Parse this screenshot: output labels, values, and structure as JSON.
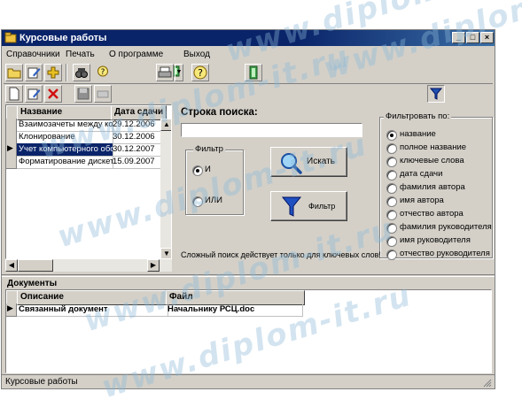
{
  "window": {
    "title": "Курсовые работы"
  },
  "menu": {
    "items": [
      "Справочники",
      "Печать",
      "О программе",
      "Выход"
    ]
  },
  "courses_grid": {
    "columns": [
      "Название",
      "Дата сдачи"
    ],
    "rows": [
      {
        "name": "Взаимозачеты между ко",
        "date": "29.12.2006"
      },
      {
        "name": "Клонирование",
        "date": "30.12.2006"
      },
      {
        "name": "Учет компьютерного обо",
        "date": "30.12.2007"
      },
      {
        "name": "Форматирование дискет",
        "date": "15.09.2007"
      }
    ],
    "selected_row": 2
  },
  "search": {
    "label": "Строка поиска:",
    "value": "",
    "search_button": "Искать",
    "filter_button": "Фильтр",
    "hint": "Сложный поиск действует только для ключевых слов!"
  },
  "filter_mode": {
    "title": "Фильтр",
    "options": [
      "И",
      "ИЛИ"
    ],
    "selected": "И"
  },
  "filter_by": {
    "title": "Фильтровать по:",
    "options": [
      "название",
      "полное название",
      "ключевые слова",
      "дата сдачи",
      "фамилия автора",
      "имя автора",
      "отчество автора",
      "фамилия руководителя",
      "имя руководителя",
      "отчество руководителя"
    ],
    "selected": "название"
  },
  "documents": {
    "title": "Документы",
    "columns": [
      "Описание",
      "Файл"
    ],
    "rows": [
      {
        "description": "Связанный документ",
        "file": "Начальнику РСЦ.doc"
      }
    ]
  },
  "status_bar": {
    "text": "Курсовые работы"
  },
  "watermark": {
    "text": "www.diplom-it.ru"
  },
  "colors": {
    "title_bar": "#0a246a",
    "face": "#d4d0c8",
    "selection": "#0a246a",
    "watermark": "#8cb9d7"
  }
}
